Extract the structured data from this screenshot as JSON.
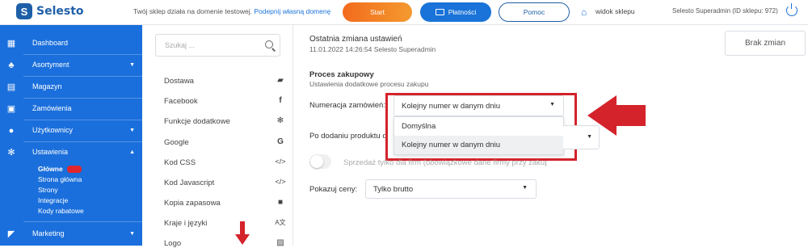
{
  "app": {
    "logo_text": "Selesto"
  },
  "topbar": {
    "trial_text": "Twój sklep działa na domenie testowej.",
    "trial_link": "Podepnij własną domenę",
    "start": "Start",
    "payments": "Płatności",
    "help": "Pomoc",
    "shop_view": "widok sklepu",
    "admin": "Selesto Superadmin (ID sklepu: 972)"
  },
  "sidebar": {
    "items": [
      {
        "label": "Dashboard",
        "icon": "grid-icon"
      },
      {
        "label": "Asortyment",
        "icon": "tag-icon",
        "caret": "▼"
      },
      {
        "label": "Magazyn",
        "icon": "warehouse-icon"
      },
      {
        "label": "Zamówienia",
        "icon": "bag-icon"
      },
      {
        "label": "Użytkownicy",
        "icon": "user-icon",
        "caret": "▼"
      },
      {
        "label": "Ustawienia",
        "icon": "gear-icon",
        "caret": "▲"
      },
      {
        "label": "Marketing",
        "icon": "megaphone-icon",
        "caret": "▼"
      }
    ],
    "subitems": [
      {
        "label": "Główne",
        "active": true
      },
      {
        "label": "Strona główna"
      },
      {
        "label": "Strony"
      },
      {
        "label": "Integracje"
      },
      {
        "label": "Kody rabatowe"
      }
    ]
  },
  "settings_menu": {
    "search_placeholder": "Szukaj ...",
    "items": [
      {
        "label": "Dostawa",
        "icon": "truck-icon"
      },
      {
        "label": "Facebook",
        "icon": "facebook-icon"
      },
      {
        "label": "Funkcje dodatkowe",
        "icon": "gears-icon"
      },
      {
        "label": "Google",
        "icon": "google-icon"
      },
      {
        "label": "Kod CSS",
        "icon": "code-icon"
      },
      {
        "label": "Kod Javascript",
        "icon": "code-icon"
      },
      {
        "label": "Kopia zapasowa",
        "icon": "save-icon"
      },
      {
        "label": "Kraje i języki",
        "icon": "language-icon"
      },
      {
        "label": "Logo",
        "icon": "image-icon"
      }
    ]
  },
  "main": {
    "last_change_title": "Ostatnia zmiana ustawień",
    "last_change_meta": "11.01.2022  14:26:54   Selesto Superadmin",
    "no_changes": "Brak zmian",
    "section_title": "Proces zakupowy",
    "section_subtitle": "Ustawienia dodatkowe procesu zakupu",
    "order_numbering_label": "Numeracja zamówień:",
    "order_numbering_value": "Kolejny numer w danym dniu",
    "order_numbering_options": [
      "Domyślna",
      "Kolejny numer w danym dniu"
    ],
    "after_add_label": "Po dodaniu produktu do k",
    "company_sale_label": "Sprzedaż tylko dla firm (obowiązkowe dane firmy przy zakupie)",
    "show_prices_label": "Pokazuj ceny:",
    "show_prices_value": "Tylko brutto"
  },
  "colors": {
    "sidebar": "#1a6fdc",
    "accent_red": "#d4232b",
    "start": "#f26b1d",
    "brand": "#1f5fa8"
  }
}
